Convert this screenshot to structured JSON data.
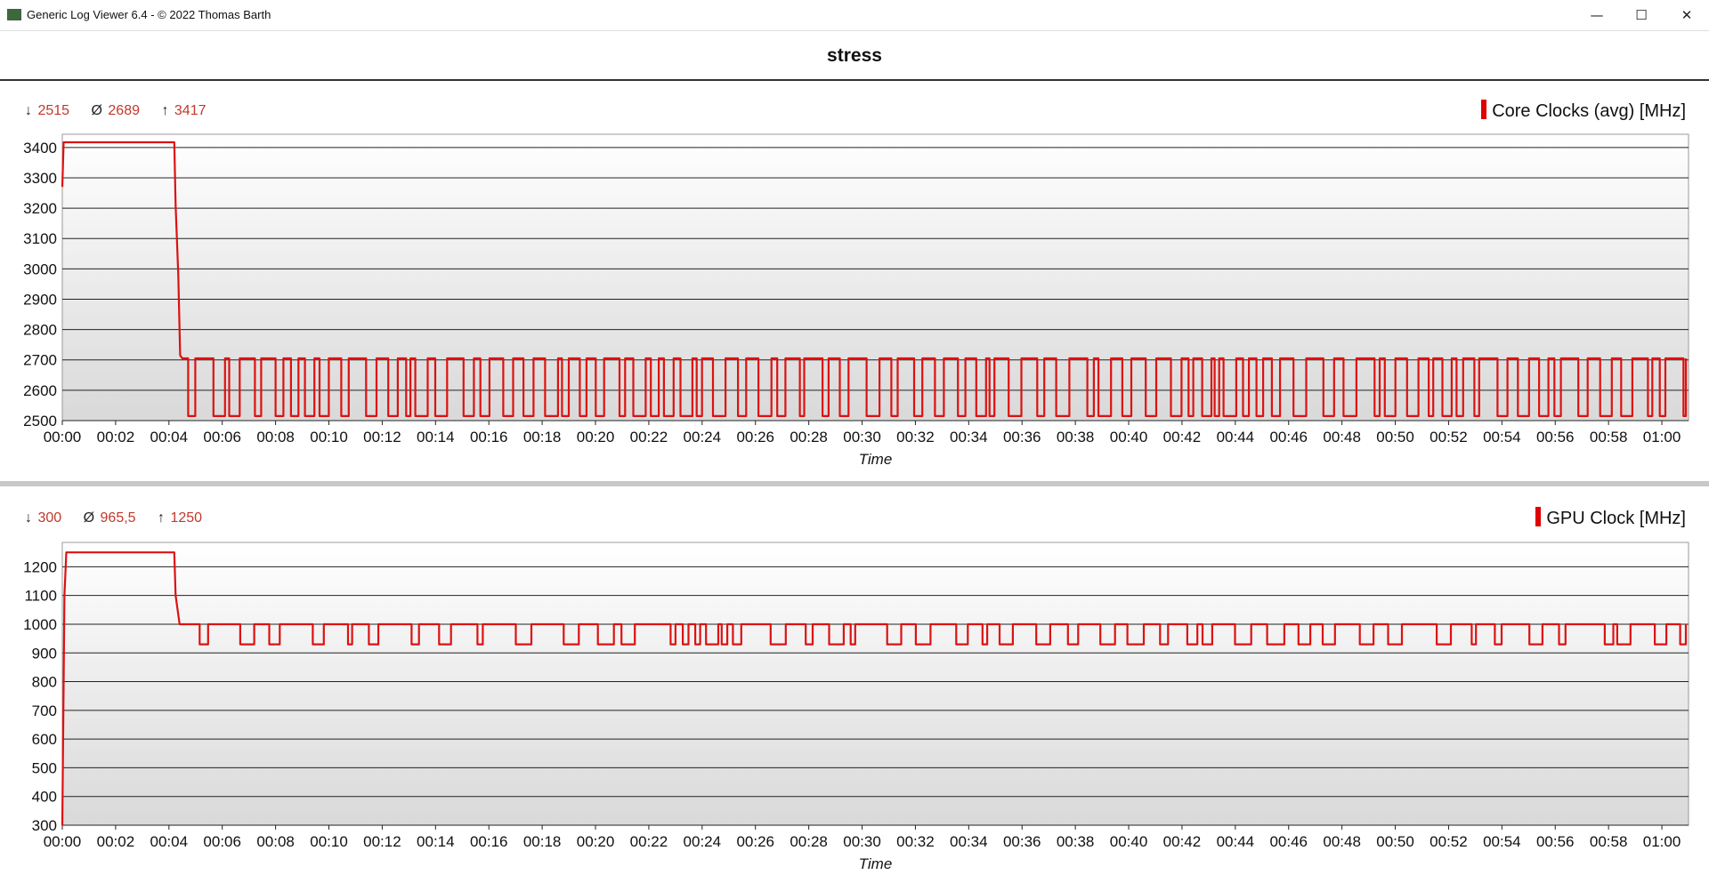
{
  "window": {
    "title": "Generic Log Viewer 6.4 - © 2022 Thomas Barth",
    "minimize_glyph": "—",
    "maximize_glyph": "☐",
    "close_glyph": "✕"
  },
  "sheet_title": "stress",
  "colors": {
    "series": "#dd1111",
    "stat_text": "#c0392b"
  },
  "panels": [
    {
      "stats": {
        "min_symbol": "↓",
        "min": "2515",
        "avg_symbol": "Ø",
        "avg": "2689",
        "max_symbol": "↑",
        "max": "3417"
      },
      "legend": "Core Clocks (avg) [MHz]"
    },
    {
      "stats": {
        "min_symbol": "↓",
        "min": "300",
        "avg_symbol": "Ø",
        "avg": "965,5",
        "max_symbol": "↑",
        "max": "1250"
      },
      "legend": "GPU Clock [MHz]"
    }
  ],
  "chart_data": [
    {
      "type": "line",
      "title": "",
      "xlabel": "Time",
      "ylabel": "",
      "x_unit": "minutes",
      "ylim": [
        2500,
        3420
      ],
      "y_ticks": [
        2500,
        2600,
        2700,
        2800,
        2900,
        3000,
        3100,
        3200,
        3300,
        3400
      ],
      "xlim": [
        0,
        61
      ],
      "x_ticks": [
        "00:00",
        "00:02",
        "00:04",
        "00:06",
        "00:08",
        "00:10",
        "00:12",
        "00:14",
        "00:16",
        "00:18",
        "00:20",
        "00:22",
        "00:24",
        "00:26",
        "00:28",
        "00:30",
        "00:32",
        "00:34",
        "00:36",
        "00:38",
        "00:40",
        "00:42",
        "00:44",
        "00:46",
        "00:48",
        "00:50",
        "00:52",
        "00:54",
        "00:56",
        "00:58",
        "01:00"
      ],
      "grid": true,
      "legend_position": "top-right",
      "series": [
        {
          "name": "Core Clocks (avg) [MHz]",
          "x": [
            0,
            0.05,
            0.1,
            4.2,
            4.25,
            4.35,
            4.42,
            4.5,
            4.55,
            4.8,
            5.2,
            10,
            14,
            18,
            20,
            26,
            28,
            30,
            34,
            40,
            44,
            50,
            54,
            58,
            61
          ],
          "y": [
            3270,
            3417,
            3417,
            3417,
            3210,
            2980,
            2715,
            2705,
            2515,
            2705,
            2515,
            2705,
            2515,
            2705,
            2515,
            2705,
            2515,
            2705,
            2515,
            2705,
            2515,
            2705,
            2515,
            2705,
            2705
          ],
          "note_pattern": "alternates between ~2705 and ~2515 MHz"
        }
      ]
    },
    {
      "type": "line",
      "title": "",
      "xlabel": "Time",
      "ylabel": "",
      "x_unit": "minutes",
      "ylim": [
        300,
        1260
      ],
      "y_ticks": [
        300,
        400,
        500,
        600,
        700,
        800,
        900,
        1000,
        1100,
        1200
      ],
      "xlim": [
        0,
        61
      ],
      "x_ticks": [
        "00:00",
        "00:02",
        "00:04",
        "00:06",
        "00:08",
        "00:10",
        "00:12",
        "00:14",
        "00:16",
        "00:18",
        "00:20",
        "00:22",
        "00:24",
        "00:26",
        "00:28",
        "00:30",
        "00:32",
        "00:34",
        "00:36",
        "00:38",
        "00:40",
        "00:42",
        "00:44",
        "00:46",
        "00:48",
        "00:50",
        "00:52",
        "00:54",
        "00:56",
        "00:58",
        "01:00"
      ],
      "grid": true,
      "legend_position": "top-right",
      "series": [
        {
          "name": "GPU Clock [MHz]",
          "x": [
            0,
            0.08,
            0.15,
            4.2,
            4.25,
            4.4,
            4.5,
            4.6,
            5.0,
            10,
            20,
            30,
            40,
            50,
            61
          ],
          "y": [
            300,
            1100,
            1250,
            1250,
            1100,
            1000,
            930,
            1000,
            930,
            1000,
            930,
            1000,
            930,
            1000,
            1000
          ],
          "note_pattern": "alternates between ~1000 and ~930 MHz"
        }
      ]
    }
  ]
}
